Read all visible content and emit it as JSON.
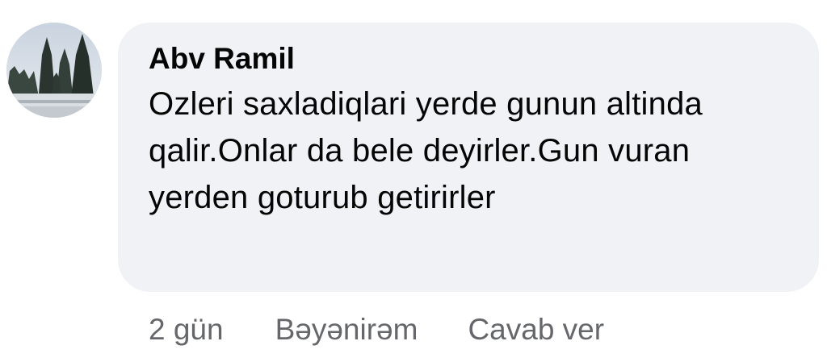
{
  "comment": {
    "author": "Abv Ramil",
    "text": "Ozleri saxladiqlari yerde gunun altinda qalir.Onlar da bele deyirler.Gun vuran yerden goturub getirirler",
    "timestamp": "2 gün",
    "like_label": "Bəyənirəm",
    "reply_label": "Cavab ver"
  },
  "colors": {
    "bubble": "#f0f2f5",
    "text": "#050505",
    "secondary": "#65676b"
  }
}
